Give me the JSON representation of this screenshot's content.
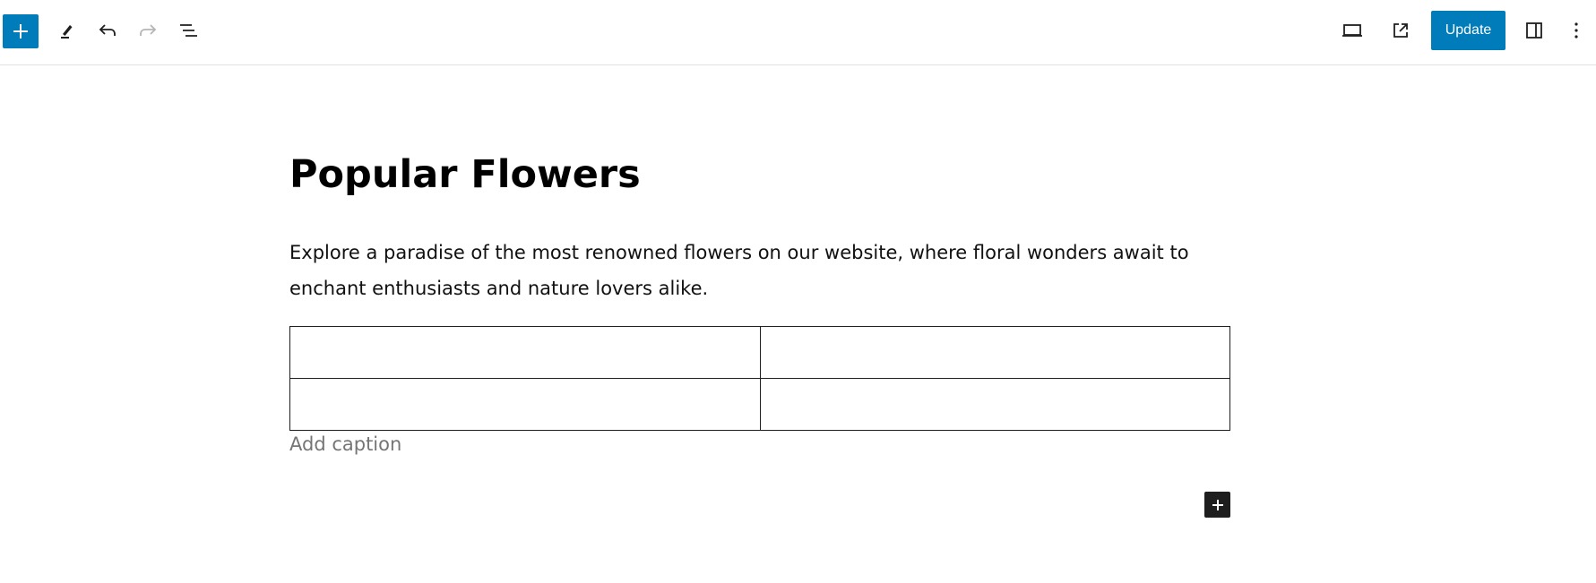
{
  "toolbar": {
    "icons": {
      "inserter": "plus-icon",
      "tools": "pencil-icon",
      "undo": "undo-icon",
      "redo": "redo-icon",
      "list_view": "list-view-icon",
      "preview": "laptop-icon",
      "view_post": "external-link-icon",
      "settings": "sidebar-panel-icon",
      "options": "more-vertical-icon"
    },
    "update_label": "Update",
    "accent_color": "#007cba"
  },
  "editor": {
    "title": "Popular Flowers",
    "paragraph": "Explore a paradise of the most renowned flowers on our website, where floral wonders await to enchant enthusiasts and nature lovers alike.",
    "table": {
      "rows": [
        [
          "",
          ""
        ],
        [
          "",
          ""
        ]
      ]
    },
    "caption_placeholder": "Add caption",
    "block_inserter_icon": "plus-icon"
  }
}
